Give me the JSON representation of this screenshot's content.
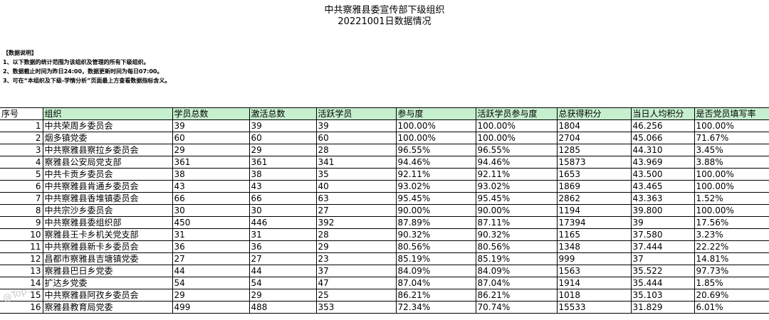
{
  "header": {
    "title": "中共察雅县委宣传部下级组织",
    "subtitle": "20221001日数据情况"
  },
  "notes": {
    "heading": "【数据说明】",
    "lines": [
      "1、以下数据的统计范围为该组织及管理的所有下级组织。",
      "2、数据截止时间为昨日24:00，数据更新时间为每日07:00。",
      "3、可在“本组织及下级-学情分析”页面最上方查看数据指标含义。"
    ]
  },
  "table": {
    "headers": [
      "序号",
      "组织",
      "学员总数",
      "激活总数",
      "活跃学员",
      "参与度",
      "活跃学员参与度",
      "总获得积分",
      "当日人均积分",
      "是否党员填写率"
    ],
    "rows": [
      [
        "1",
        "中共荣周乡委员会",
        "39",
        "39",
        "39",
        "100.00%",
        "100.00%",
        "1804",
        "46.256",
        "100.00%"
      ],
      [
        "2",
        "烟多镇党委",
        "60",
        "60",
        "60",
        "100.00%",
        "100.00%",
        "2704",
        "45.066",
        "71.67%"
      ],
      [
        "3",
        "中共察雅县察拉乡委员会",
        "29",
        "29",
        "28",
        "96.55%",
        "96.55%",
        "1285",
        "44.310",
        "3.45%"
      ],
      [
        "4",
        "察雅县公安局党支部",
        "361",
        "361",
        "341",
        "94.46%",
        "94.46%",
        "15873",
        "43.969",
        "3.88%"
      ],
      [
        "5",
        "中共卡贡乡委员会",
        "38",
        "38",
        "35",
        "92.11%",
        "92.11%",
        "1653",
        "43.500",
        "100.00%"
      ],
      [
        "6",
        "中共察雅县肯通乡委员会",
        "43",
        "43",
        "40",
        "93.02%",
        "93.02%",
        "1869",
        "43.465",
        "100.00%"
      ],
      [
        "7",
        "中共察雅县香堆镇委员会",
        "66",
        "66",
        "63",
        "95.45%",
        "95.45%",
        "2862",
        "43.363",
        "1.52%"
      ],
      [
        "8",
        "中共宗沙乡委员会",
        "30",
        "30",
        "27",
        "90.00%",
        "90.00%",
        "1194",
        "39.800",
        "100.00%"
      ],
      [
        "9",
        "中共察雅县委组织部",
        "450",
        "446",
        "392",
        "87.89%",
        "87.11%",
        "17394",
        "39",
        "17.56%"
      ],
      [
        "10",
        "察雅县王卡乡机关党支部",
        "31",
        "31",
        "28",
        "90.32%",
        "90.32%",
        "1165",
        "37.580",
        "3.23%"
      ],
      [
        "11",
        "中共察雅县新卡乡委员会",
        "36",
        "36",
        "29",
        "80.56%",
        "80.56%",
        "1348",
        "37.444",
        "22.22%"
      ],
      [
        "12",
        "昌都市察雅县吉塘镇党委",
        "27",
        "27",
        "23",
        "85.19%",
        "85.19%",
        "999",
        "37",
        "14.81%"
      ],
      [
        "13",
        "察雅县巴日乡党委",
        "44",
        "44",
        "37",
        "84.09%",
        "84.09%",
        "1563",
        "35.522",
        "97.73%"
      ],
      [
        "14",
        "扩达乡党委",
        "54",
        "54",
        "47",
        "87.04%",
        "87.04%",
        "1914",
        "35.444",
        "1.85%"
      ],
      [
        "15",
        "中共察雅县阿孜乡委员会",
        "29",
        "29",
        "25",
        "86.21%",
        "86.21%",
        "1018",
        "35.103",
        "20.69%"
      ],
      [
        "16",
        "察雅县教育局党委",
        "499",
        "488",
        "353",
        "72.34%",
        "70.74%",
        "15533",
        "31.829",
        "6.01%"
      ]
    ]
  },
  "watermark": {
    "text": "@Top..."
  }
}
